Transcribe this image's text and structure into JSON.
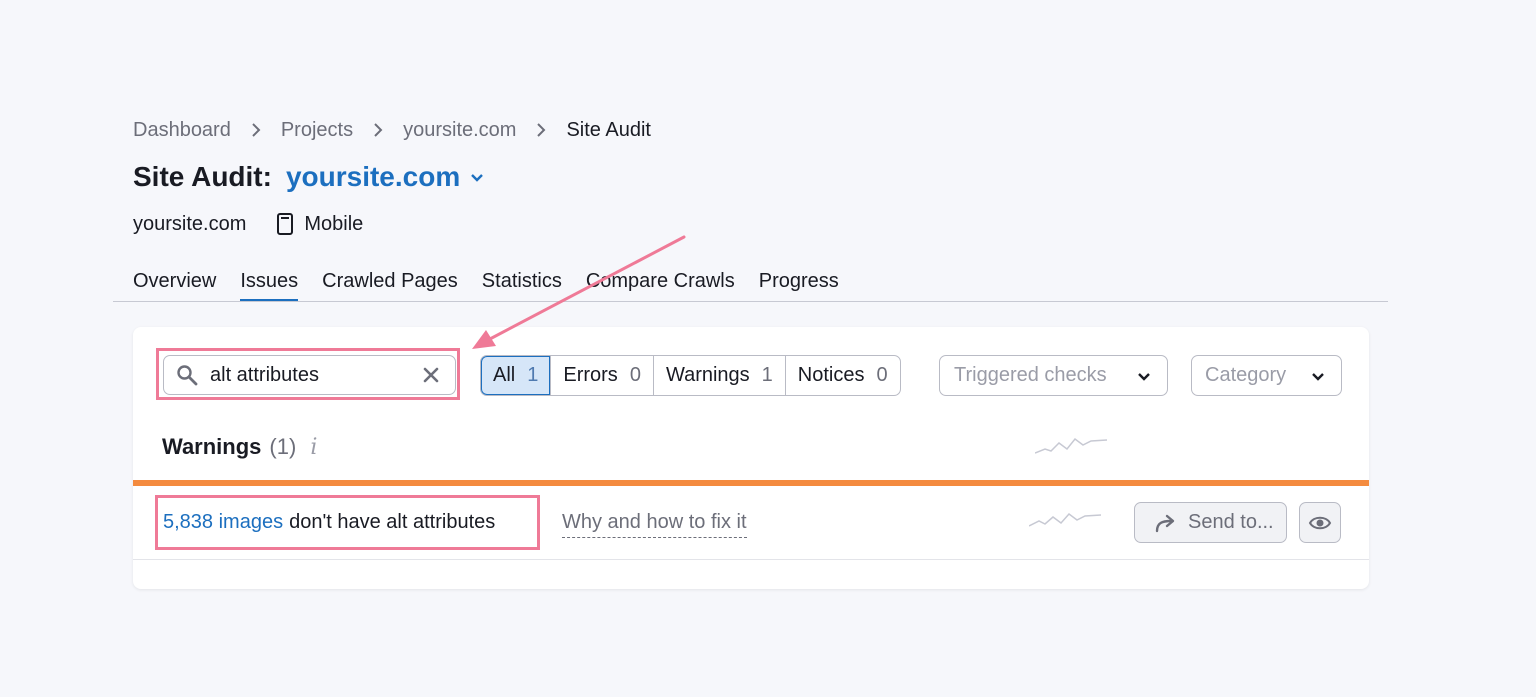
{
  "breadcrumb": {
    "items": [
      "Dashboard",
      "Projects",
      "yoursite.com",
      "Site Audit"
    ]
  },
  "title": {
    "prefix": "Site Audit:",
    "domain": "yoursite.com"
  },
  "meta": {
    "domain": "yoursite.com",
    "device": "Mobile"
  },
  "tabs": [
    "Overview",
    "Issues",
    "Crawled Pages",
    "Statistics",
    "Compare Crawls",
    "Progress"
  ],
  "active_tab": "Issues",
  "search": {
    "value": "alt attributes"
  },
  "filters": [
    {
      "label": "All",
      "count": "1",
      "active": true
    },
    {
      "label": "Errors",
      "count": "0"
    },
    {
      "label": "Warnings",
      "count": "1"
    },
    {
      "label": "Notices",
      "count": "0"
    }
  ],
  "dropdowns": {
    "triggered": "Triggered checks",
    "category": "Category"
  },
  "warnings_section": {
    "label": "Warnings",
    "count": "(1)",
    "info": "i"
  },
  "issue": {
    "link": "5,838 images",
    "text": "don't have alt attributes",
    "howto": "Why and how to fix it",
    "send": "Send to..."
  },
  "colors": {
    "accent": "#1c6fbf",
    "warning_bar": "#f48b3f",
    "highlight": "#ef7a97"
  }
}
